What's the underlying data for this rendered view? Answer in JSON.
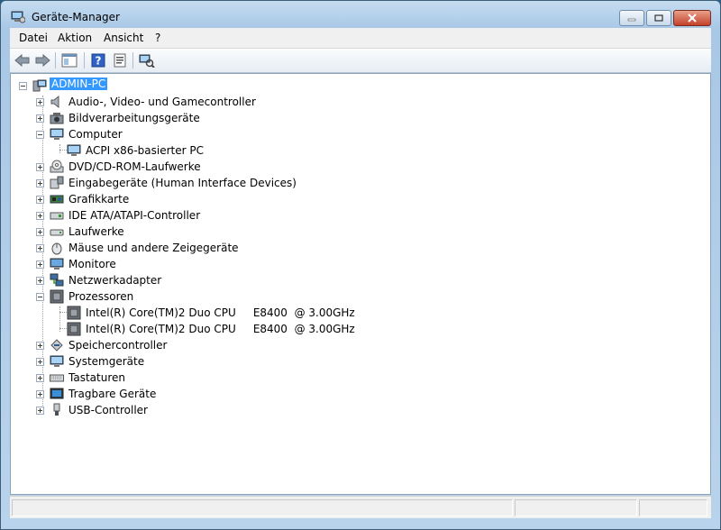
{
  "window": {
    "title": "Geräte-Manager"
  },
  "menubar": {
    "items": [
      "Datei",
      "Aktion",
      "Ansicht",
      "?"
    ]
  },
  "toolbar": {
    "buttons": [
      "back-icon",
      "forward-icon",
      "console-tree-icon",
      "help-icon",
      "scan-hardware-icon"
    ]
  },
  "tree": {
    "root": "ADMIN-PC",
    "nodes": [
      {
        "label": "Audio-, Video- und Gamecontroller",
        "icon": "speaker-icon",
        "expanded": false
      },
      {
        "label": "Bildverarbeitungsgeräte",
        "icon": "camera-icon",
        "expanded": false
      },
      {
        "label": "Computer",
        "icon": "computer-icon",
        "expanded": true
      },
      {
        "label": "ACPI x86-basierter PC",
        "icon": "computer-icon",
        "child": true
      },
      {
        "label": "DVD/CD-ROM-Laufwerke",
        "icon": "dvd-drive-icon",
        "expanded": false
      },
      {
        "label": "Eingabegeräte (Human Interface Devices)",
        "icon": "hid-icon",
        "expanded": false
      },
      {
        "label": "Grafikkarte",
        "icon": "display-adapter-icon",
        "expanded": false
      },
      {
        "label": "IDE ATA/ATAPI-Controller",
        "icon": "ide-controller-icon",
        "expanded": false
      },
      {
        "label": "Laufwerke",
        "icon": "disk-drive-icon",
        "expanded": false
      },
      {
        "label": "Mäuse und andere Zeigegeräte",
        "icon": "mouse-icon",
        "expanded": false
      },
      {
        "label": "Monitore",
        "icon": "monitor-icon",
        "expanded": false
      },
      {
        "label": "Netzwerkadapter",
        "icon": "network-adapter-icon",
        "expanded": false
      },
      {
        "label": "Prozessoren",
        "icon": "processor-icon",
        "expanded": true
      },
      {
        "label": "Intel(R) Core(TM)2 Duo CPU     E8400  @ 3.00GHz",
        "icon": "processor-icon",
        "child": true
      },
      {
        "label": "Intel(R) Core(TM)2 Duo CPU     E8400  @ 3.00GHz",
        "icon": "processor-icon",
        "child": true
      },
      {
        "label": "Speichercontroller",
        "icon": "storage-controller-icon",
        "expanded": false
      },
      {
        "label": "Systemgeräte",
        "icon": "system-devices-icon",
        "expanded": false
      },
      {
        "label": "Tastaturen",
        "icon": "keyboard-icon",
        "expanded": false
      },
      {
        "label": "Tragbare Geräte",
        "icon": "portable-device-icon",
        "expanded": false
      },
      {
        "label": "USB-Controller",
        "icon": "usb-icon",
        "expanded": false
      }
    ]
  },
  "colors": {
    "selection": "#3399ff",
    "window_frame": "#b9d3ec",
    "background": "#2a5d86"
  }
}
